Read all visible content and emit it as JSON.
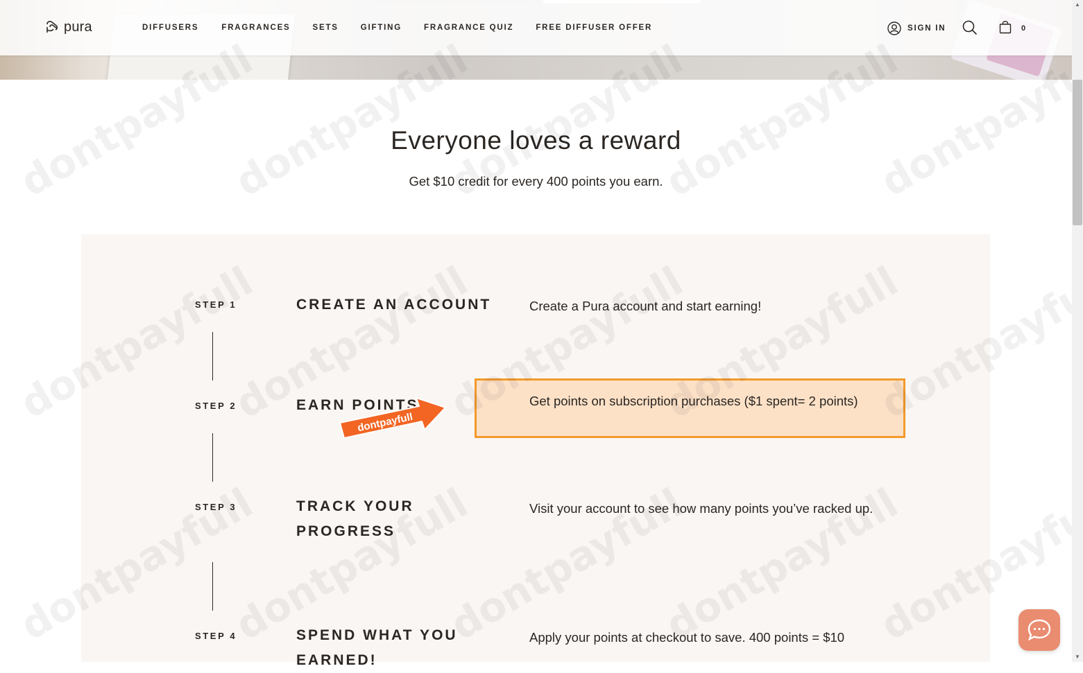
{
  "header": {
    "logo_text": "pura",
    "nav": [
      {
        "label": "DIFFUSERS"
      },
      {
        "label": "FRAGRANCES"
      },
      {
        "label": "SETS"
      },
      {
        "label": "GIFTING"
      },
      {
        "label": "FRAGRANCE QUIZ"
      },
      {
        "label": "FREE DIFFUSER OFFER"
      }
    ],
    "sign_in": "SIGN IN",
    "cart_count": "0"
  },
  "hero": {
    "headline": "Everyone loves a reward",
    "subhead": "Get $10 credit for every 400 points you earn."
  },
  "steps": [
    {
      "label": "STEP 1",
      "title": "CREATE AN ACCOUNT",
      "desc": "Create a Pura account and start earning!"
    },
    {
      "label": "STEP 2",
      "title": "EARN POINTS",
      "desc": "Get points on subscription purchases ($1 spent= 2 points)"
    },
    {
      "label": "STEP 3",
      "title": "TRACK YOUR PROGRESS",
      "desc": "Visit your account to see how many points you’ve racked up."
    },
    {
      "label": "STEP 4",
      "title": "SPEND WHAT YOU EARNED!",
      "desc": "Apply your points at checkout to save. 400 points = $10"
    }
  ],
  "overlay": {
    "badge_text": "dontpayfull",
    "watermark": "dontpayfull",
    "highlight_color": "#f39a2b",
    "badge_color": "#f26522"
  },
  "icons": {
    "chat": "chat-bubble-icon",
    "search": "search-icon",
    "cart": "shopping-bag-icon",
    "user": "user-icon"
  }
}
